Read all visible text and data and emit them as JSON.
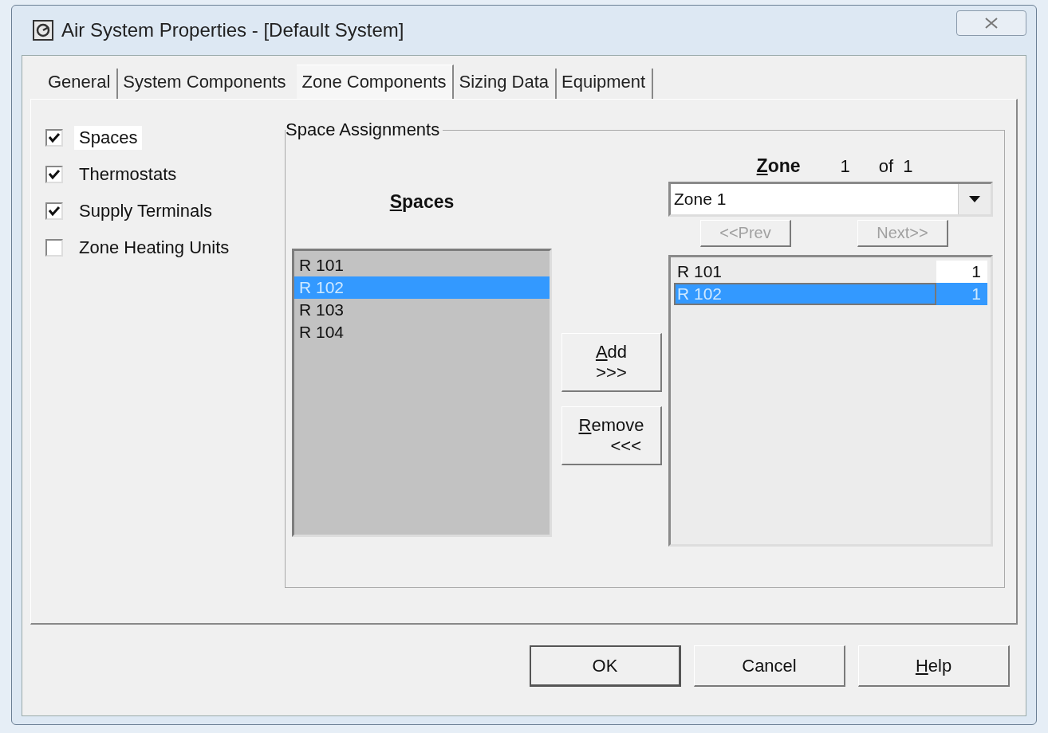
{
  "window": {
    "title": "Air System Properties - [Default System]"
  },
  "tabs": [
    {
      "label": "General",
      "selected": false,
      "separator": true
    },
    {
      "label": "System Components",
      "selected": false,
      "separator": false
    },
    {
      "label": "Zone Components",
      "selected": true,
      "separator": true
    },
    {
      "label": "Sizing Data",
      "selected": false,
      "separator": true
    },
    {
      "label": "Equipment",
      "selected": false,
      "separator": true
    }
  ],
  "options": [
    {
      "label": "Spaces",
      "checked": true,
      "focused": true
    },
    {
      "label": "Thermostats",
      "checked": true,
      "focused": false
    },
    {
      "label": "Supply Terminals",
      "checked": true,
      "focused": false
    },
    {
      "label": "Zone Heating Units",
      "checked": false,
      "focused": false
    }
  ],
  "space_assignments": {
    "title": "Space Assignments",
    "spaces": {
      "heading": "Spaces",
      "underline_first": true,
      "items": [
        {
          "name": "R 101",
          "selected": false
        },
        {
          "name": "R 102",
          "selected": true
        },
        {
          "name": "R 103",
          "selected": false
        },
        {
          "name": "R 104",
          "selected": false
        }
      ]
    },
    "add_button": {
      "label": "Add",
      "arrows": ">>>",
      "underline_first": true
    },
    "remove_button": {
      "label": "Remove",
      "arrows": "<<<",
      "underline_first": true
    },
    "zone": {
      "heading": "Zone",
      "underline_first": true,
      "number": "1",
      "of": "of",
      "total": "1",
      "combo_value": "Zone 1",
      "prev": {
        "label": "<<Prev",
        "disabled": true
      },
      "next": {
        "label": "Next>>",
        "disabled": true
      },
      "assigned": [
        {
          "name": "R 101",
          "count": "1",
          "selected": false
        },
        {
          "name": "R 102",
          "count": "1",
          "selected": true
        }
      ]
    }
  },
  "buttons": [
    {
      "label": "OK",
      "default": true,
      "underline_first": false
    },
    {
      "label": "Cancel",
      "default": false,
      "underline_first": false
    },
    {
      "label": "Help",
      "default": false,
      "underline_first": true
    }
  ]
}
